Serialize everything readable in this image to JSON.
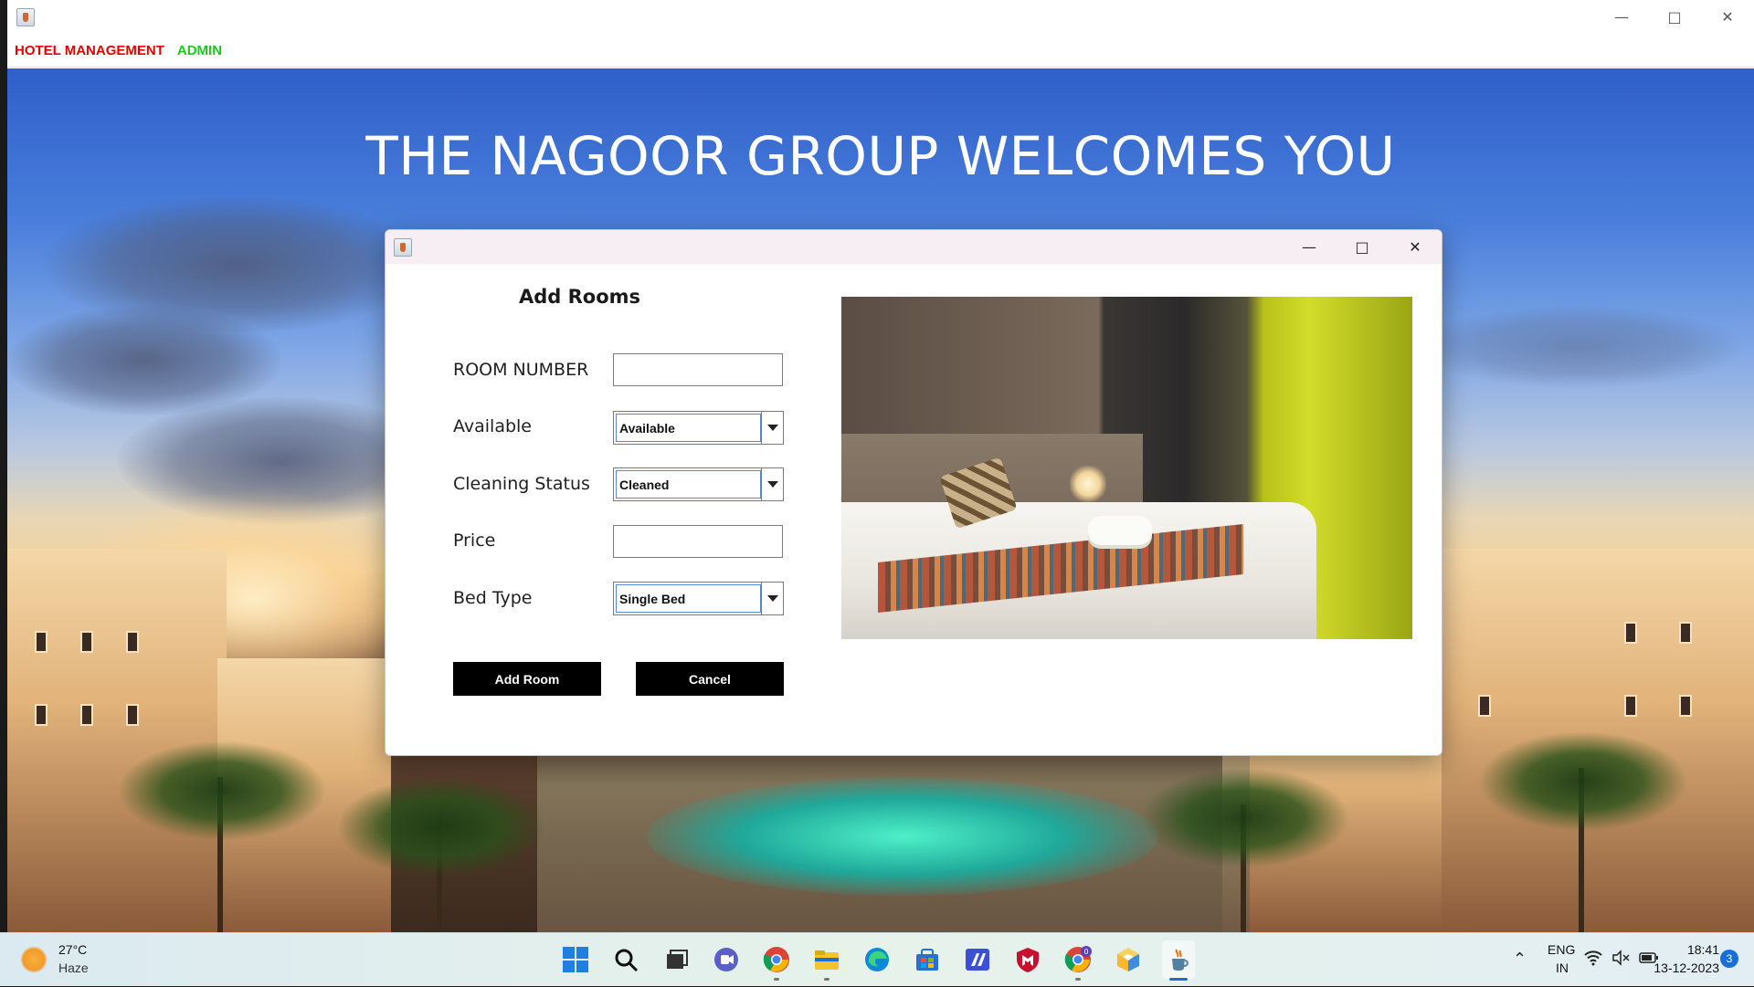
{
  "main_window": {
    "menu": {
      "hotel_label": "HOTEL MANAGEMENT",
      "admin_label": "ADMIN"
    },
    "welcome_text": "THE NAGOOR GROUP WELCOMES YOU"
  },
  "dialog": {
    "heading": "Add Rooms",
    "fields": {
      "room_number": {
        "label": "ROOM NUMBER",
        "value": ""
      },
      "available": {
        "label": "Available",
        "selected": "Available"
      },
      "cleaning_status": {
        "label": "Cleaning Status",
        "selected": "Cleaned"
      },
      "price": {
        "label": "Price",
        "value": ""
      },
      "bed_type": {
        "label": "Bed Type",
        "selected": "Single Bed"
      }
    },
    "buttons": {
      "add_room": "Add Room",
      "cancel": "Cancel"
    }
  },
  "taskbar": {
    "weather": {
      "temperature": "27°C",
      "condition": "Haze"
    },
    "pinned_icons": [
      "start-icon",
      "search-icon",
      "task-view-icon",
      "teams-icon",
      "chrome-icon",
      "file-explorer-icon",
      "edge-icon",
      "store-icon",
      "pen-app-icon",
      "mcafee-icon",
      "chrome-profile-icon",
      "cube-app-icon",
      "java-icon"
    ],
    "tray": {
      "lang_line1": "ENG",
      "lang_line2": "IN",
      "time": "18:41",
      "date": "13-12-2023",
      "notification_count": "3"
    }
  }
}
